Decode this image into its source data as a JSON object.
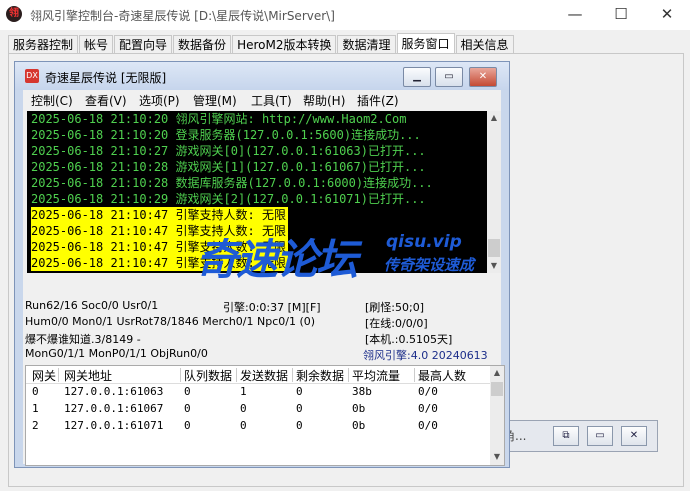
{
  "window": {
    "title": "翎风引擎控制台-奇速星辰传说 [D:\\星辰传说\\MirServer\\]",
    "minimize": "—",
    "maximize": "☐",
    "close": "✕"
  },
  "tabs": [
    "服务器控制",
    "帐号",
    "配置向导",
    "数据备份",
    "HeroM2版本转换",
    "数据清理",
    "服务窗口",
    "相关信息"
  ],
  "active_tab_index": 6,
  "background_window": {
    "label": "角..."
  },
  "child": {
    "title": "奇速星辰传说 [无限版]",
    "menu": [
      "控制(C)",
      "查看(V)",
      "选项(P)",
      "管理(M)",
      "工具(T)",
      "帮助(H)",
      "插件(Z)"
    ],
    "console_lines": [
      {
        "text": "2025-06-18 21:10:20 翎风引擎网站: http://www.Haom2.Com",
        "highlight": false
      },
      {
        "text": "2025-06-18 21:10:20 登录服务器(127.0.0.1:5600)连接成功...",
        "highlight": false
      },
      {
        "text": "2025-06-18 21:10:27 游戏网关[0](127.0.0.1:61063)已打开...",
        "highlight": false
      },
      {
        "text": "2025-06-18 21:10:28 游戏网关[1](127.0.0.1:61067)已打开...",
        "highlight": false
      },
      {
        "text": "2025-06-18 21:10:28 数据库服务器(127.0.0.1:6000)连接成功...",
        "highlight": false
      },
      {
        "text": "2025-06-18 21:10:29 游戏网关[2](127.0.0.1:61071)已打开...",
        "highlight": false
      },
      {
        "text": "2025-06-18 21:10:47 引擎支持人数: 无限",
        "highlight": true
      },
      {
        "text": "2025-06-18 21:10:47 引擎支持人数: 无限",
        "highlight": true
      },
      {
        "text": "2025-06-18 21:10:47 引擎支持人数: 无限",
        "highlight": true
      },
      {
        "text": "2025-06-18 21:10:47 引擎支持人数: 无限",
        "highlight": true
      }
    ],
    "status": {
      "row1_left": "Run62/16 Soc0/0 Usr0/1",
      "row1_mid": "引擎:0:0:37 [M][F]",
      "row1_right": "[刷怪:50;0]",
      "row2_left": "Hum0/0 Mon0/1 UsrRot78/1846 Merch0/1 Npc0/1 (0)",
      "row2_right": "[在线:0/0/0]",
      "row3_left": "爆不爆谁知道.3/8149 -",
      "row3_right": "[本机.:0.5105天]",
      "row4_left": "MonG0/1/1 MonP0/1/1 ObjRun0/0",
      "row4_right": "翎风引擎:4.0 20240613"
    },
    "table": {
      "headers": [
        "网关",
        "网关地址",
        "队列数据",
        "发送数据",
        "剩余数据",
        "平均流量",
        "最高人数"
      ],
      "rows": [
        [
          "0",
          "127.0.0.1:61063",
          "0",
          "1",
          "0",
          "38b",
          "0/0"
        ],
        [
          "1",
          "127.0.0.1:61067",
          "0",
          "0",
          "0",
          "0b",
          "0/0"
        ],
        [
          "2",
          "127.0.0.1:61071",
          "0",
          "0",
          "0",
          "0b",
          "0/0"
        ]
      ]
    }
  },
  "watermark": {
    "name": "奇速论坛",
    "url": "qisu.vip",
    "slogan": "传奇架设速成"
  }
}
